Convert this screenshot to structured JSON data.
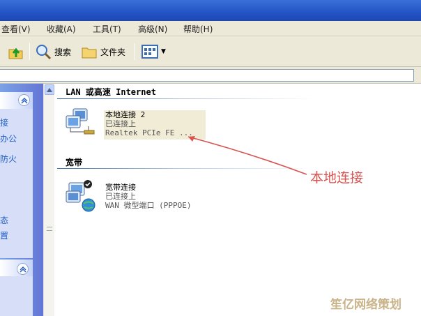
{
  "menu": {
    "items": [
      "查看(V)",
      "收藏(A)",
      "工具(T)",
      "高级(N)",
      "帮助(H)"
    ]
  },
  "toolbar": {
    "search_label": "搜索",
    "folders_label": "文件夹"
  },
  "taskpane": {
    "links": [
      "接",
      "办公",
      "防火",
      "态",
      "置"
    ]
  },
  "groups": {
    "lan_header": "LAN 或高速 Internet",
    "broadband_header": "宽带"
  },
  "connections": [
    {
      "name": "本地连接 2",
      "status": "已连接上",
      "device": "Realtek PCIe FE ..."
    },
    {
      "name": "宽带连接",
      "status": "已连接上",
      "device": "WAN 微型端口 (PPPOE)"
    }
  ],
  "annotation": {
    "label": "本地连接",
    "color": "#d9534f"
  },
  "watermark": "笙亿网络策划",
  "colors": {
    "titlebar": "#2454c6",
    "taskpane": "#6375d6",
    "chrome": "#ece9d8"
  }
}
